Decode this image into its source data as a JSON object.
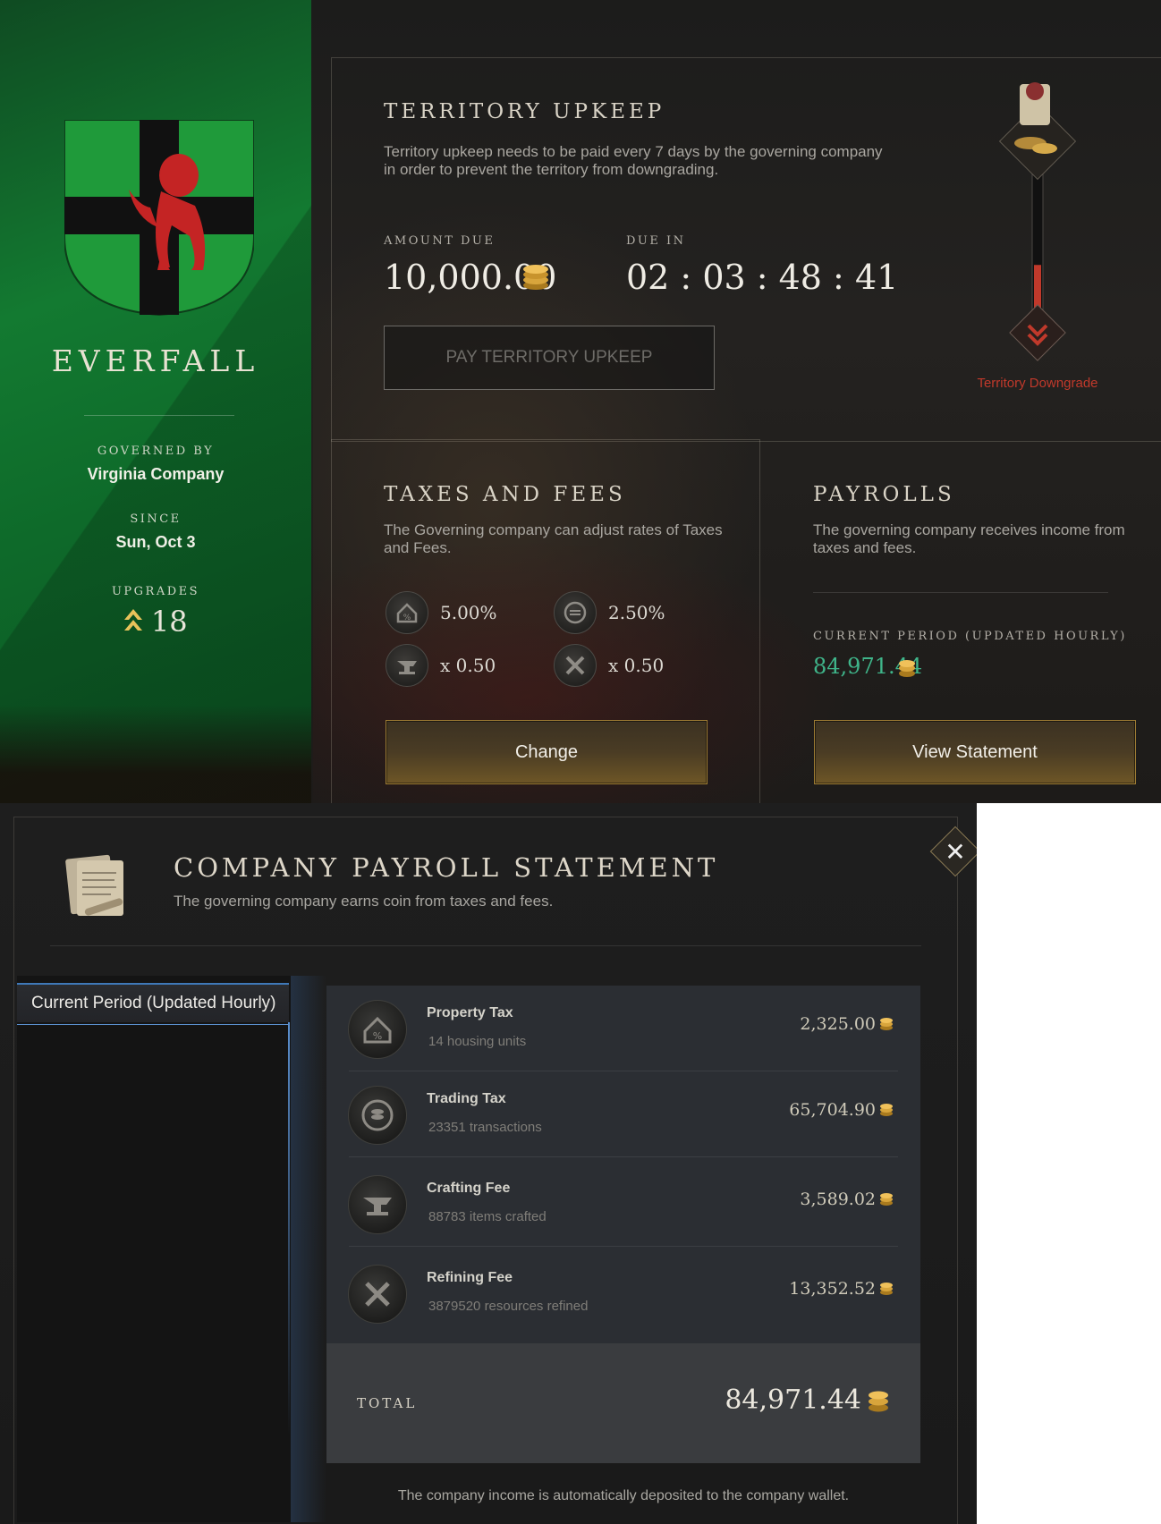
{
  "territory": {
    "name": "EVERFALL",
    "governed_by_label": "GOVERNED BY",
    "governed_by": "Virginia Company",
    "since_label": "SINCE",
    "since": "Sun, Oct 3",
    "upgrades_label": "UPGRADES",
    "upgrades": "18",
    "banner_color": "#137a31",
    "crest_color": "#1da33d"
  },
  "upkeep": {
    "title": "TERRITORY UPKEEP",
    "description": "Territory upkeep needs to be paid every 7 days by the governing company in order to prevent the territory from downgrading.",
    "amount_due_label": "AMOUNT DUE",
    "amount_due": "10,000.00",
    "due_in_label": "DUE IN",
    "due_in": "02 : 03 : 48 : 41",
    "pay_button": "PAY TERRITORY UPKEEP",
    "downgrade_label": "Territory Downgrade",
    "downgrade_progress": 0.36,
    "downgrade_color": "#c0392b"
  },
  "taxes": {
    "title": "TAXES AND FEES",
    "description": "The Governing company can adjust rates of Taxes and Fees.",
    "property_tax": "5.00%",
    "trading_tax": "2.50%",
    "crafting_fee": "x 0.50",
    "refining_fee": "x 0.50",
    "change_button": "Change"
  },
  "payrolls": {
    "title": "PAYROLLS",
    "description": "The governing company receives income from taxes and fees.",
    "period_label": "CURRENT PERIOD (UPDATED HOURLY)",
    "period_value": "84,971.44",
    "value_color": "#3fb58a",
    "view_button": "View Statement"
  },
  "statement": {
    "title": "COMPANY PAYROLL STATEMENT",
    "subtitle": "The governing company earns coin from taxes and fees.",
    "tab_current": "Current Period (Updated Hourly)",
    "rows": [
      {
        "name": "Property Tax",
        "detail": "14 housing units",
        "amount": "2,325.00",
        "icon": "house-icon"
      },
      {
        "name": "Trading Tax",
        "detail": "23351 transactions",
        "amount": "65,704.90",
        "icon": "trade-coins-icon"
      },
      {
        "name": "Crafting Fee",
        "detail": "88783 items crafted",
        "amount": "3,589.02",
        "icon": "anvil-icon"
      },
      {
        "name": "Refining Fee",
        "detail": "3879520 resources refined",
        "amount": "13,352.52",
        "icon": "hammer-pick-icon"
      }
    ],
    "total_label": "TOTAL",
    "total": "84,971.44",
    "footer": "The company income is automatically deposited to the company wallet."
  }
}
